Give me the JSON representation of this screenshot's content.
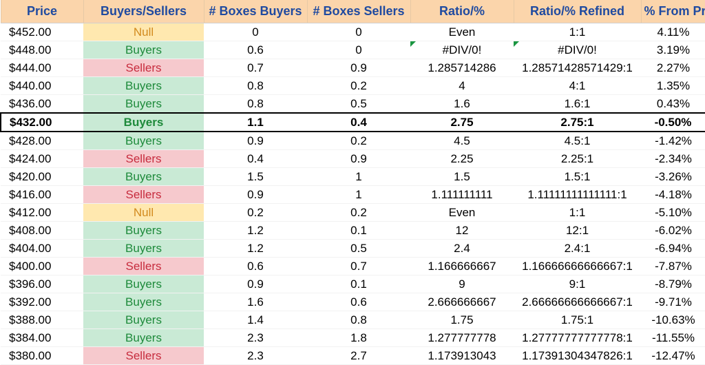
{
  "headers": {
    "price": "Price",
    "bs": "Buyers/Sellers",
    "boxesBuyers": "# Boxes Buyers",
    "boxesSellers": "# Boxes Sellers",
    "ratio": "Ratio/%",
    "ratioRefined": "Ratio/% Refined",
    "pctFromPrice": "% From Price"
  },
  "colors": {
    "headerBg": "#fbd5ab",
    "headerText": "#1f4aa0",
    "buyersBg": "#c9ead5",
    "buyersText": "#1e8a3b",
    "sellersBg": "#f6c9cd",
    "sellersText": "#c72c3e",
    "nullBg": "#ffe8af",
    "nullText": "#d28a1d",
    "errorFlag": "#1a9641"
  },
  "highlightIndex": 5,
  "rows": [
    {
      "price": "$452.00",
      "bs": "Null",
      "bsClass": "bs-null",
      "boxesBuyers": "0",
      "boxesSellers": "0",
      "ratio": "Even",
      "ratioRefined": "1:1",
      "pctFromPrice": "4.11%",
      "flagRatio": false,
      "flagRefined": false
    },
    {
      "price": "$448.00",
      "bs": "Buyers",
      "bsClass": "bs-buyers",
      "boxesBuyers": "0.6",
      "boxesSellers": "0",
      "ratio": "#DIV/0!",
      "ratioRefined": "#DIV/0!",
      "pctFromPrice": "3.19%",
      "flagRatio": true,
      "flagRefined": true
    },
    {
      "price": "$444.00",
      "bs": "Sellers",
      "bsClass": "bs-sellers",
      "boxesBuyers": "0.7",
      "boxesSellers": "0.9",
      "ratio": "1.285714286",
      "ratioRefined": "1.28571428571429:1",
      "pctFromPrice": "2.27%",
      "flagRatio": false,
      "flagRefined": false
    },
    {
      "price": "$440.00",
      "bs": "Buyers",
      "bsClass": "bs-buyers",
      "boxesBuyers": "0.8",
      "boxesSellers": "0.2",
      "ratio": "4",
      "ratioRefined": "4:1",
      "pctFromPrice": "1.35%",
      "flagRatio": false,
      "flagRefined": false
    },
    {
      "price": "$436.00",
      "bs": "Buyers",
      "bsClass": "bs-buyers",
      "boxesBuyers": "0.8",
      "boxesSellers": "0.5",
      "ratio": "1.6",
      "ratioRefined": "1.6:1",
      "pctFromPrice": "0.43%",
      "flagRatio": false,
      "flagRefined": false
    },
    {
      "price": "$432.00",
      "bs": "Buyers",
      "bsClass": "bs-buyers",
      "boxesBuyers": "1.1",
      "boxesSellers": "0.4",
      "ratio": "2.75",
      "ratioRefined": "2.75:1",
      "pctFromPrice": "-0.50%",
      "flagRatio": false,
      "flagRefined": false
    },
    {
      "price": "$428.00",
      "bs": "Buyers",
      "bsClass": "bs-buyers",
      "boxesBuyers": "0.9",
      "boxesSellers": "0.2",
      "ratio": "4.5",
      "ratioRefined": "4.5:1",
      "pctFromPrice": "-1.42%",
      "flagRatio": false,
      "flagRefined": false
    },
    {
      "price": "$424.00",
      "bs": "Sellers",
      "bsClass": "bs-sellers",
      "boxesBuyers": "0.4",
      "boxesSellers": "0.9",
      "ratio": "2.25",
      "ratioRefined": "2.25:1",
      "pctFromPrice": "-2.34%",
      "flagRatio": false,
      "flagRefined": false
    },
    {
      "price": "$420.00",
      "bs": "Buyers",
      "bsClass": "bs-buyers",
      "boxesBuyers": "1.5",
      "boxesSellers": "1",
      "ratio": "1.5",
      "ratioRefined": "1.5:1",
      "pctFromPrice": "-3.26%",
      "flagRatio": false,
      "flagRefined": false
    },
    {
      "price": "$416.00",
      "bs": "Sellers",
      "bsClass": "bs-sellers",
      "boxesBuyers": "0.9",
      "boxesSellers": "1",
      "ratio": "1.111111111",
      "ratioRefined": "1.11111111111111:1",
      "pctFromPrice": "-4.18%",
      "flagRatio": false,
      "flagRefined": false
    },
    {
      "price": "$412.00",
      "bs": "Null",
      "bsClass": "bs-null",
      "boxesBuyers": "0.2",
      "boxesSellers": "0.2",
      "ratio": "Even",
      "ratioRefined": "1:1",
      "pctFromPrice": "-5.10%",
      "flagRatio": false,
      "flagRefined": false
    },
    {
      "price": "$408.00",
      "bs": "Buyers",
      "bsClass": "bs-buyers",
      "boxesBuyers": "1.2",
      "boxesSellers": "0.1",
      "ratio": "12",
      "ratioRefined": "12:1",
      "pctFromPrice": "-6.02%",
      "flagRatio": false,
      "flagRefined": false
    },
    {
      "price": "$404.00",
      "bs": "Buyers",
      "bsClass": "bs-buyers",
      "boxesBuyers": "1.2",
      "boxesSellers": "0.5",
      "ratio": "2.4",
      "ratioRefined": "2.4:1",
      "pctFromPrice": "-6.94%",
      "flagRatio": false,
      "flagRefined": false
    },
    {
      "price": "$400.00",
      "bs": "Sellers",
      "bsClass": "bs-sellers",
      "boxesBuyers": "0.6",
      "boxesSellers": "0.7",
      "ratio": "1.166666667",
      "ratioRefined": "1.16666666666667:1",
      "pctFromPrice": "-7.87%",
      "flagRatio": false,
      "flagRefined": false
    },
    {
      "price": "$396.00",
      "bs": "Buyers",
      "bsClass": "bs-buyers",
      "boxesBuyers": "0.9",
      "boxesSellers": "0.1",
      "ratio": "9",
      "ratioRefined": "9:1",
      "pctFromPrice": "-8.79%",
      "flagRatio": false,
      "flagRefined": false
    },
    {
      "price": "$392.00",
      "bs": "Buyers",
      "bsClass": "bs-buyers",
      "boxesBuyers": "1.6",
      "boxesSellers": "0.6",
      "ratio": "2.666666667",
      "ratioRefined": "2.66666666666667:1",
      "pctFromPrice": "-9.71%",
      "flagRatio": false,
      "flagRefined": false
    },
    {
      "price": "$388.00",
      "bs": "Buyers",
      "bsClass": "bs-buyers",
      "boxesBuyers": "1.4",
      "boxesSellers": "0.8",
      "ratio": "1.75",
      "ratioRefined": "1.75:1",
      "pctFromPrice": "-10.63%",
      "flagRatio": false,
      "flagRefined": false
    },
    {
      "price": "$384.00",
      "bs": "Buyers",
      "bsClass": "bs-buyers",
      "boxesBuyers": "2.3",
      "boxesSellers": "1.8",
      "ratio": "1.277777778",
      "ratioRefined": "1.27777777777778:1",
      "pctFromPrice": "-11.55%",
      "flagRatio": false,
      "flagRefined": false
    },
    {
      "price": "$380.00",
      "bs": "Sellers",
      "bsClass": "bs-sellers",
      "boxesBuyers": "2.3",
      "boxesSellers": "2.7",
      "ratio": "1.173913043",
      "ratioRefined": "1.17391304347826:1",
      "pctFromPrice": "-12.47%",
      "flagRatio": false,
      "flagRefined": false
    }
  ]
}
